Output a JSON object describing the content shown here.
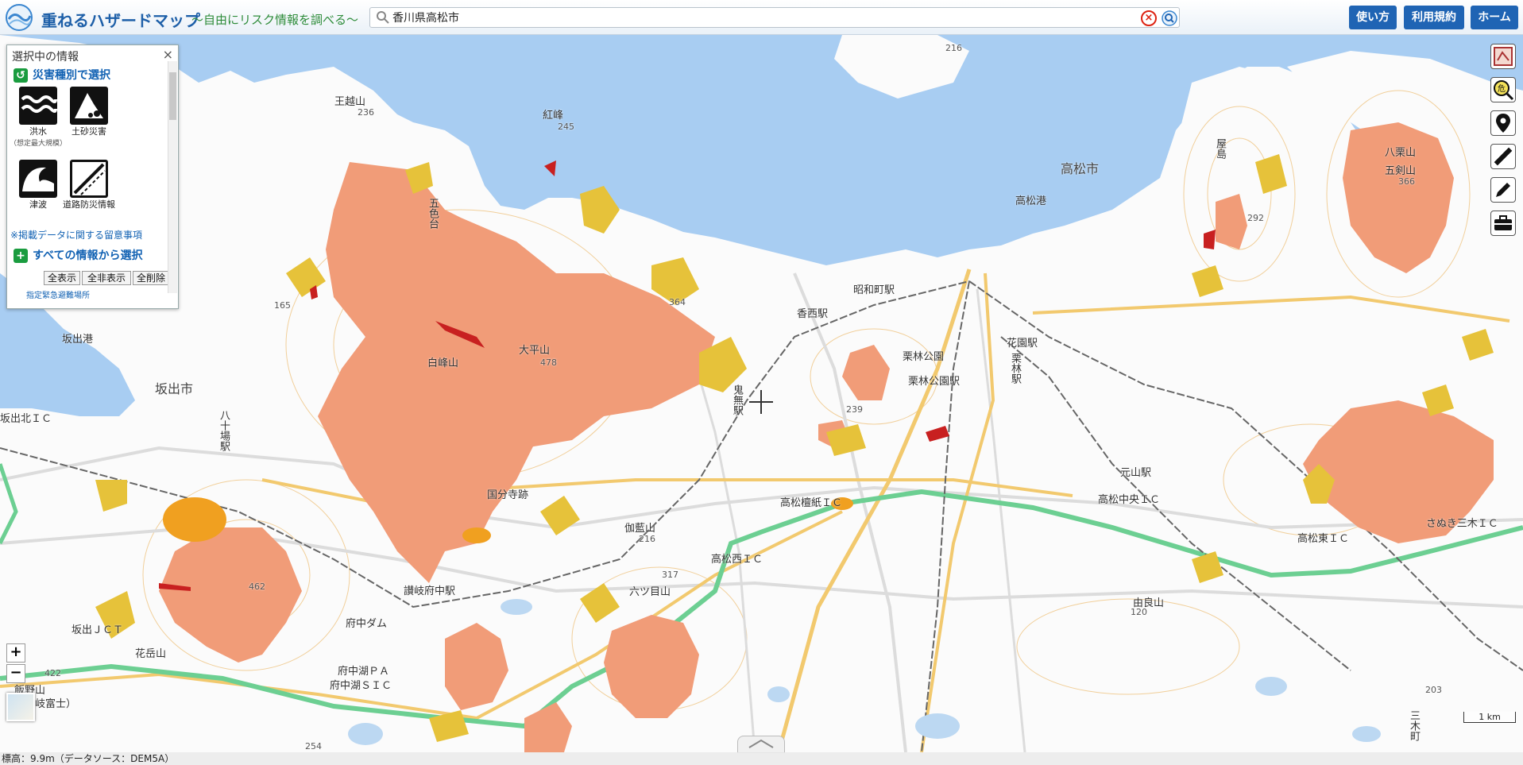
{
  "header": {
    "title": "重ねるハザードマップ",
    "subtitle": "～自由にリスク情報を調べる～",
    "search_value": "香川県高松市",
    "buttons": {
      "usage": "使い方",
      "terms": "利用規約",
      "home": "ホーム"
    }
  },
  "panel": {
    "title": "選択中の情報",
    "close": "×",
    "select_by_type": "災害種別で選択",
    "hazards": [
      {
        "label": "洪水",
        "sub": "（想定最大規模）",
        "icon": "flood-icon"
      },
      {
        "label": "土砂災害",
        "icon": "landslide-icon"
      },
      {
        "label": "津波",
        "icon": "tsunami-icon"
      },
      {
        "label": "道路防災情報",
        "icon": "road-icon"
      }
    ],
    "notice": "※掲載データに関する留意事項",
    "select_all_info": "すべての情報から選択",
    "buttons": {
      "show_all": "全表示",
      "hide_all": "全非表示",
      "delete_all": "全削除"
    },
    "evac_link": "指定緊急避難場所"
  },
  "tools": [
    "map-select-icon",
    "hazard-check-icon",
    "location-pin-icon",
    "ruler-icon",
    "pencil-icon",
    "toolbox-icon"
  ],
  "zoom": {
    "in": "+",
    "out": "−"
  },
  "footer": {
    "elevation": "標高：9.9m（データソース：DEM5A）"
  },
  "scale": "1 km",
  "map_labels": {
    "takamatsu_city": "高松市",
    "sakaide_city": "坂出市",
    "sakaide_port": "坂出港",
    "takamatsu_port": "高松港",
    "kokubunji": "国分寺跡",
    "ritsurin": "栗林公園",
    "ritsurin_st": "栗林公園駅",
    "ritsurin_st2": "栗林駅",
    "showacho": "昭和町駅",
    "kozai": "香西駅",
    "sanuki_fuchu": "讃岐府中駅",
    "hanazono": "花園駅",
    "motoyama": "元山駅",
    "ic_takamatsu_central": "高松中央ＩＣ",
    "ic_takamatsu_hinoki": "高松檀紙ＩＣ",
    "ic_takamatsu_west": "高松西ＩＣ",
    "ic_takamatsu_east": "高松東ＩＣ",
    "ic_fuchuko": "府中湖ＳＩＣ",
    "ic_fuchuko_pa": "府中湖ＰＡ",
    "ic_sanuki_miki": "さぬき三木ＩＣ",
    "fuchu_dam": "府中ダム",
    "sakaide_jct": "坂出ＪＣＴ",
    "sakaide_kita": "坂出北ＩＣ",
    "yaso": "八十場駅",
    "kamonmatsu": "鬼無駅",
    "goshikidai": "五色台",
    "otaki": "大平山",
    "shiromine": "白峰山",
    "owashi": "王越山",
    "kannon": "紅峰",
    "yashima": "屋島",
    "goken": "五剣山",
    "hachiko": "八栗山",
    "miki": "三木町",
    "yurayama": "由良山",
    "kagetsu": "伽藍山",
    "amagiri": "六ツ目山",
    "iioyama": "飯野山",
    "sanuki_fuji": "（讃岐富士）",
    "hanaenoyama": "花岳山",
    "elev_216": "216",
    "elev_236": "236",
    "elev_245": "245",
    "elev_165": "165",
    "elev_364": "364",
    "elev_478": "478",
    "elev_239": "239",
    "elev_292": "292",
    "elev_366": "366",
    "elev_317": "317",
    "elev_462": "462",
    "elev_422": "422",
    "elev_120": "120",
    "elev_203": "203",
    "elev_254": "254",
    "elev_216b": "216"
  },
  "colors": {
    "sea": "#a8cdf2",
    "land": "#fbfbfb",
    "landslide_area": "#f19c78",
    "steep_slope": "#e6c23a",
    "debris_flow": "#f0a020",
    "special_zone": "#c82020",
    "expressway": "#6ccf92",
    "national_road": "#f2c96e",
    "railway": "#666666"
  }
}
